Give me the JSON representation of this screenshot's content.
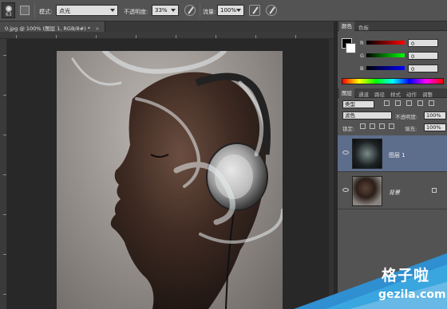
{
  "options_bar": {
    "tool_size": "63",
    "mode_label": "模式:",
    "mode_value": "点光",
    "opacity_label": "不透明度:",
    "opacity_value": "33%",
    "flow_label": "流量:",
    "flow_value": "100%"
  },
  "document": {
    "tab_title": "0.jpg @ 100% (图层 1, RGB/8#) *",
    "close_glyph": "×"
  },
  "color_panel": {
    "tabs": [
      "颜色",
      "色板"
    ],
    "channels": [
      {
        "label": "R",
        "value": "0",
        "color": "#d42a2a"
      },
      {
        "label": "G",
        "value": "0",
        "color": "#2aa52a"
      },
      {
        "label": "B",
        "value": "0",
        "color": "#2a3ad4"
      }
    ]
  },
  "layers_panel": {
    "tabs": [
      "图层",
      "通道",
      "路径",
      "样式",
      "动作",
      "调整"
    ],
    "filter_label": "类型",
    "blend_mode": "滤色",
    "opacity_label": "不透明度:",
    "opacity_value": "100%",
    "lock_label": "锁定:",
    "fill_label": "填充:",
    "fill_value": "100%",
    "layers": [
      {
        "name": "图层 1",
        "selected": true
      },
      {
        "name": "背景",
        "selected": false
      }
    ]
  },
  "watermark": {
    "brand": "格子啦",
    "url": "gezila.com"
  },
  "colors": {
    "selection": "#5d6d8c",
    "watermark_blue": "#3aa6e0"
  }
}
